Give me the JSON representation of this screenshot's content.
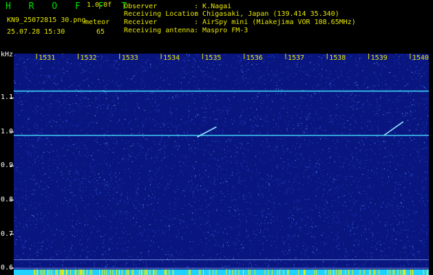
{
  "header": {
    "title": "H R O F F T",
    "version": "1.0.0f",
    "filename": "KN9_25072815 30.png",
    "mode": "meteor",
    "datetime": "25.07.28 15:30",
    "count": "65"
  },
  "info": [
    {
      "label": "Observer",
      "value": "K.Nagai"
    },
    {
      "label": "Receiving Location",
      "value": "Chigasaki, Japan (139.414 35.340)"
    },
    {
      "label": "Receiver",
      "value": "AirSpy mini (Miakejima VOR 108.65MHz)"
    },
    {
      "label": "Receiving antenna",
      "value": "Maspro FM-3"
    }
  ],
  "colors": {
    "background": "#0a1680",
    "header": "#000000",
    "text": "#e8e800",
    "title": "#00e000",
    "carrier": "#40e0ff"
  },
  "chart_data": {
    "type": "heatmap",
    "yunit": "kHz",
    "ylim": [
      0.58,
      1.23
    ],
    "yticks": [
      "1.1",
      "1.0",
      "0.9",
      "0.8",
      "0.7",
      "0.6"
    ],
    "xticks": [
      "1531",
      "1532",
      "1533",
      "1534",
      "1535",
      "1536",
      "1537",
      "1538",
      "1539",
      "1540"
    ],
    "carriers_khz": [
      1.12,
      0.99
    ],
    "meteor_echoes": [
      {
        "minute": 1535.1,
        "khz_start": 0.985,
        "khz_end": 1.015
      },
      {
        "minute": 1539.6,
        "khz_start": 0.99,
        "khz_end": 1.03
      }
    ]
  }
}
